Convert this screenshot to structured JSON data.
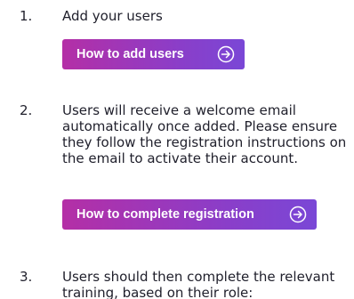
{
  "steps": [
    {
      "number": "1.",
      "text": "Add your users",
      "button": {
        "label": "How to add users",
        "icon": "arrow-right-circle-icon"
      }
    },
    {
      "number": "2.",
      "text": "Users will receive a welcome email automatically once added. Please ensure they follow the registration instructions on the email to activate their account.",
      "button": {
        "label": "How to complete registration",
        "icon": "arrow-right-circle-icon"
      }
    },
    {
      "number": "3.",
      "text": "Users should then complete the relevant training, based on their role:"
    }
  ],
  "colors": {
    "button_gradient_start": "#b42fa6",
    "button_gradient_end": "#7a47d6",
    "text": "#1f1f2b"
  }
}
